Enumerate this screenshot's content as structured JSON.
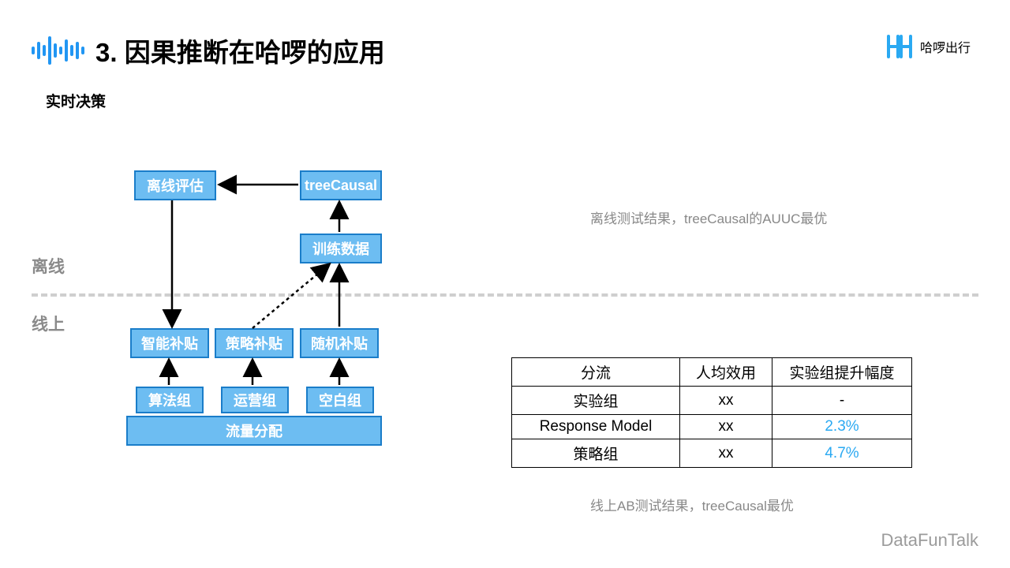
{
  "title": "3. 因果推断在哈啰的应用",
  "subtitle": "实时决策",
  "brand_text": "哈啰出行",
  "footer": "DataFunTalk",
  "labels": {
    "offline": "离线",
    "online": "线上"
  },
  "boxes": {
    "offline_eval": "离线评估",
    "tree_causal": "treeCausal",
    "train_data": "训练数据",
    "smart_sub": "智能补贴",
    "strategy_sub": "策略补贴",
    "random_sub": "随机补贴",
    "algo_group": "算法组",
    "ops_group": "运营组",
    "blank_group": "空白组",
    "traffic": "流量分配"
  },
  "notes": {
    "offline_result": "离线测试结果，treeCausal的AUUC最优",
    "online_result": "线上AB测试结果，treeCausal最优"
  },
  "table": {
    "headers": [
      "分流",
      "人均效用",
      "实验组提升幅度"
    ],
    "rows": [
      {
        "c0": "实验组",
        "c1": "xx",
        "c2": "-",
        "hl": false
      },
      {
        "c0": "Response Model",
        "c1": "xx",
        "c2": "2.3%",
        "hl": true
      },
      {
        "c0": "策略组",
        "c1": "xx",
        "c2": "4.7%",
        "hl": true
      }
    ]
  },
  "chart_data": {
    "type": "table",
    "title": "线上AB测试结果",
    "columns": [
      "分流",
      "人均效用",
      "实验组提升幅度"
    ],
    "rows": [
      [
        "实验组",
        "xx",
        "-"
      ],
      [
        "Response Model",
        "xx",
        "2.3%"
      ],
      [
        "策略组",
        "xx",
        "4.7%"
      ]
    ]
  }
}
